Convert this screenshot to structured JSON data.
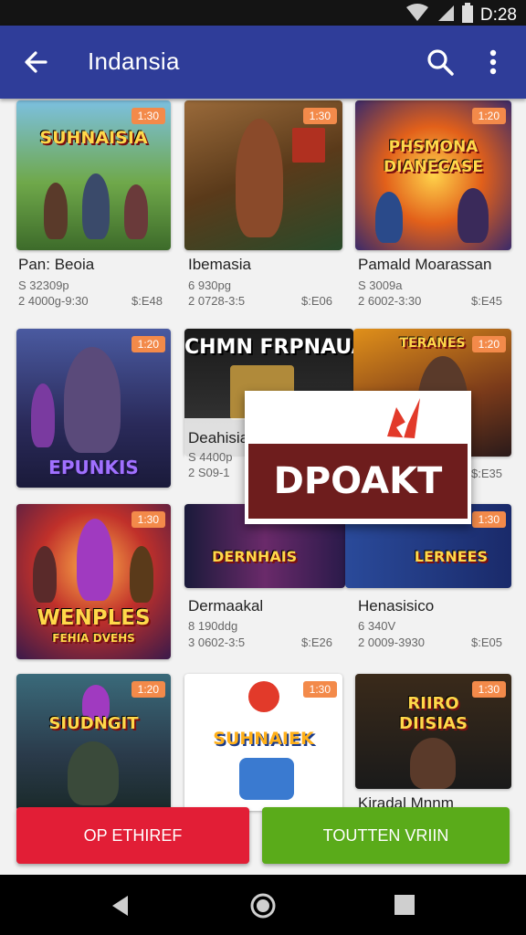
{
  "status_bar": {
    "time": "D:28",
    "icons": [
      "wifi-icon",
      "signal-icon",
      "battery-icon"
    ]
  },
  "app_bar": {
    "title": "Indansia",
    "icons": [
      "back-arrow-icon",
      "search-icon",
      "more-vert-icon"
    ]
  },
  "colors": {
    "app_bar": "#2f3d99",
    "badge": "#f38a4a",
    "red_button": "#e21e36",
    "green_button": "#5aab1a",
    "popup_band": "#6e1d1d"
  },
  "games": [
    {
      "art": "SUHNAISIA",
      "badge": "1:30",
      "name": "Pan: Beoia",
      "sub": "S 32309p",
      "size": "2 4000g-9:30",
      "price": "$:E48"
    },
    {
      "art": "",
      "badge": "1:30",
      "name": "Ibemasia",
      "sub": "6 930pg",
      "size": "2 0728-3:5",
      "price": "$:E06"
    },
    {
      "art": "PHSMONA DIANECASE",
      "badge": "1:20",
      "name": "Pamald Moarassan",
      "sub": "S 3009a",
      "size": "2 6002-3:30",
      "price": "$:E45"
    },
    {
      "art": "EPUNKIS",
      "badge": "1:20",
      "name": "",
      "sub": "",
      "size": "",
      "price": ""
    },
    {
      "art": "CHMN FRPNAUAN",
      "badge": "",
      "name": "Deahisia",
      "sub": "S 4400p",
      "size": "2 S09-1",
      "price": ""
    },
    {
      "art": "TERANES",
      "badge": "1:20",
      "name": "",
      "sub": "",
      "size": "",
      "price": "$:E35"
    },
    {
      "art": "WENPLES",
      "art2": "FEHIA DVEHS",
      "badge": "1:30",
      "name": "",
      "sub": "",
      "size": "",
      "price": ""
    },
    {
      "art": "DERNHAIS",
      "badge": "1:30",
      "name": "Dermaakal",
      "sub": "8 190ddg",
      "size": "3 0602-3:5",
      "price": "$:E26"
    },
    {
      "art": "LERNEES",
      "badge": "1:30",
      "name": "Henasisico",
      "sub": "6 340V",
      "size": "2 0009-3930",
      "price": "$:E05"
    },
    {
      "art": "SIUDNGIT",
      "badge": "1:20",
      "name": "",
      "sub": "",
      "size": "",
      "price": ""
    },
    {
      "art": "SUHNAIEK",
      "badge": "1:30",
      "name": "",
      "sub": "",
      "size": "",
      "price": ""
    },
    {
      "art": "RIIRO DIISIAS",
      "badge": "1:30",
      "name": "Kiradal Mnnm",
      "sub": "",
      "size": "",
      "price": ""
    }
  ],
  "popup": {
    "label": "DPOAKT"
  },
  "buttons": {
    "left": "OP ETHIREF",
    "right": "TOUTTEN VRIIN"
  },
  "nav_bar": {
    "icons": [
      "back-triangle-icon",
      "home-circle-icon",
      "recents-square-icon"
    ]
  }
}
